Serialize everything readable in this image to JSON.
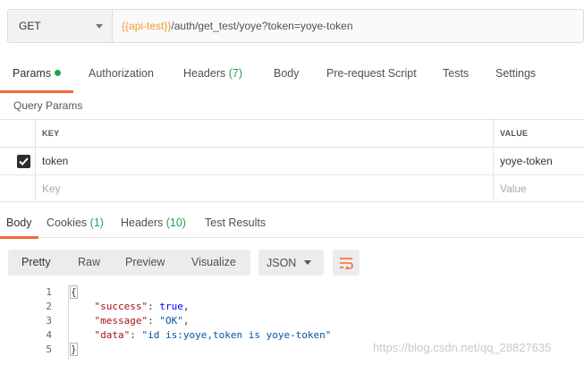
{
  "request": {
    "method": "GET",
    "url_variable": "{{api-test}}",
    "url_path": "/auth/get_test/yoye?token=yoye-token"
  },
  "request_tabs": [
    {
      "label": "Params",
      "active": true
    },
    {
      "label": "Authorization"
    },
    {
      "label": "Headers",
      "count": "(7)"
    },
    {
      "label": "Body"
    },
    {
      "label": "Pre-request Script"
    },
    {
      "label": "Tests"
    },
    {
      "label": "Settings"
    }
  ],
  "params": {
    "title": "Query Params",
    "headers": {
      "key": "KEY",
      "value": "VALUE"
    },
    "rows": [
      {
        "checked": true,
        "key": "token",
        "value": "yoye-token"
      }
    ],
    "placeholder": {
      "key": "Key",
      "value": "Value"
    }
  },
  "response_tabs": [
    {
      "label": "Body",
      "active": true
    },
    {
      "label": "Cookies",
      "count": "(1)"
    },
    {
      "label": "Headers",
      "count": "(10)"
    },
    {
      "label": "Test Results"
    }
  ],
  "response_view": {
    "modes": [
      "Pretty",
      "Raw",
      "Preview",
      "Visualize"
    ],
    "format": "JSON"
  },
  "code": {
    "line_numbers": [
      "1",
      "2",
      "3",
      "4",
      "5"
    ],
    "open_brace": "{",
    "close_brace": "}",
    "lines": [
      {
        "key": "\"success\"",
        "value": "true",
        "type": "bool",
        "comma": ","
      },
      {
        "key": "\"message\"",
        "value": "\"OK\"",
        "type": "string",
        "comma": ","
      },
      {
        "key": "\"data\"",
        "value": "\"id is:yoye,token is yoye-token\"",
        "type": "string",
        "comma": ""
      }
    ]
  },
  "watermark": "https://blog.csdn.net/qq_28827635",
  "colors": {
    "accent": "#f26b3a",
    "count_green": "#26a04a",
    "variable_orange": "#f09d2e"
  }
}
